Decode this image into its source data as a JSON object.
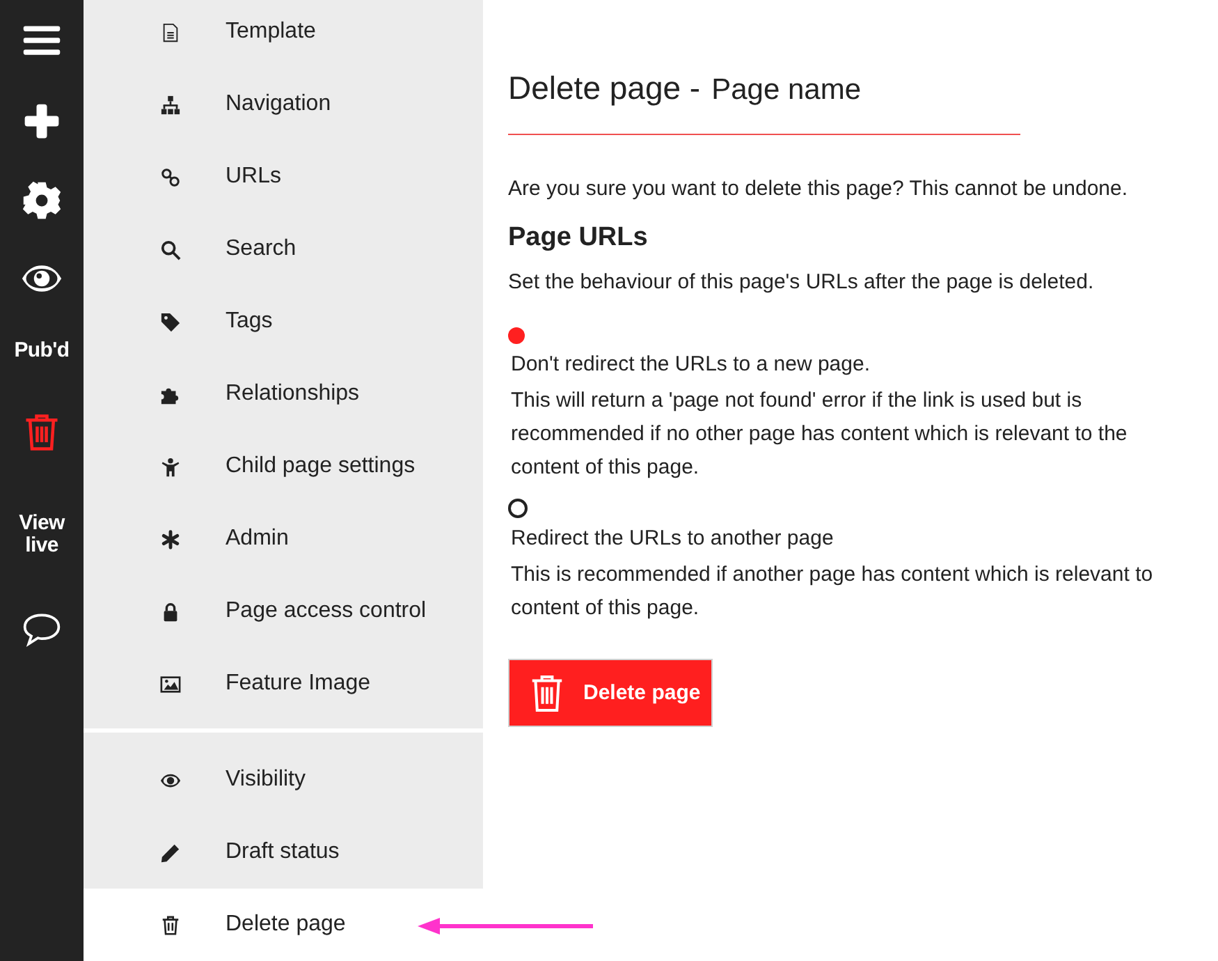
{
  "rail": [
    {
      "kind": "icon",
      "selected": false
    },
    {
      "kind": "icon",
      "selected": false
    },
    {
      "kind": "icon",
      "selected": false
    },
    {
      "kind": "icon",
      "selected": false
    },
    {
      "kind": "text",
      "label": "Pub'd",
      "selected": false
    },
    {
      "kind": "icon",
      "selected": true
    },
    {
      "kind": "text",
      "label": "View live",
      "selected": false
    },
    {
      "kind": "icon",
      "selected": false
    }
  ],
  "sidebar": {
    "groups": [
      {
        "items": [
          {
            "label": "Template",
            "selected": false
          },
          {
            "label": "Navigation",
            "selected": false
          },
          {
            "label": "URLs",
            "selected": false
          },
          {
            "label": "Search",
            "selected": false
          },
          {
            "label": "Tags",
            "selected": false
          },
          {
            "label": "Relationships",
            "selected": false
          },
          {
            "label": "Child page settings",
            "selected": false
          },
          {
            "label": "Admin",
            "selected": false
          },
          {
            "label": "Page access control",
            "selected": false
          },
          {
            "label": "Feature Image",
            "selected": false
          }
        ]
      },
      {
        "items": [
          {
            "label": "Visibility",
            "selected": false
          },
          {
            "label": "Draft status",
            "selected": false
          },
          {
            "label": "Delete page",
            "selected": true
          }
        ]
      }
    ]
  },
  "main": {
    "title": "Delete page -",
    "page_name": "Page name",
    "warning": "Are you sure you want to delete this page? This cannot be undone.",
    "section_title": "Page URLs",
    "section_description": "Set the behaviour of this page's URLs after the page is deleted.",
    "options": [
      {
        "label": "Don't redirect the URLs to a new page.",
        "description": "This will return a 'page not found' error if the link is used but is recommended if no other page has content which is relevant to the content of this page.",
        "selected": true
      },
      {
        "label": "Redirect the URLs to another page",
        "description": "This is recommended if another page has content which is relevant to content of this page.",
        "selected": false
      }
    ],
    "delete_button": "Delete page"
  }
}
